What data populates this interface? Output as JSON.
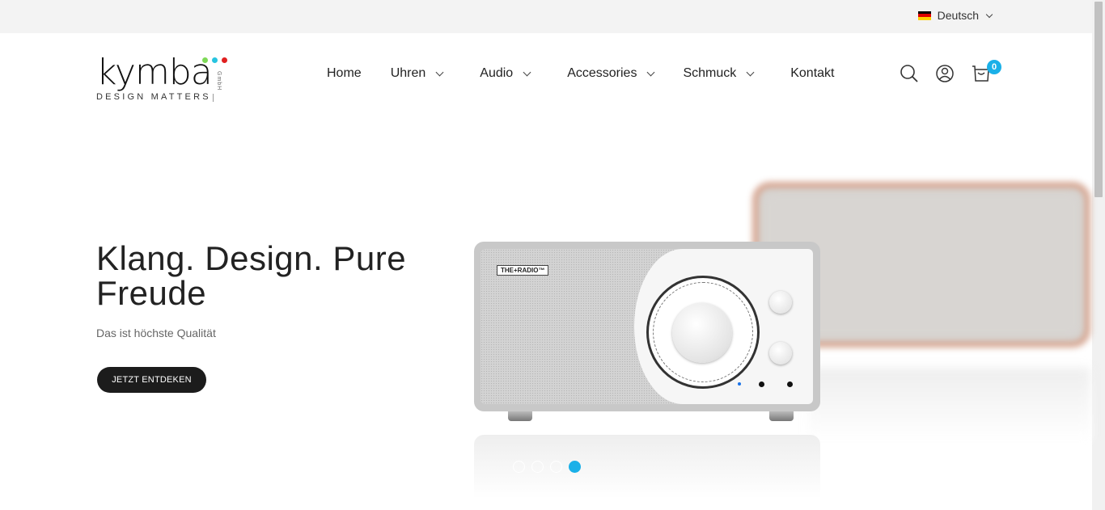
{
  "topbar": {
    "language": "Deutsch"
  },
  "brand": {
    "name": "kymba",
    "tagline": "DESIGN MATTERS",
    "suffix": "GmbH"
  },
  "nav": [
    {
      "label": "Home",
      "has_dropdown": false
    },
    {
      "label": "Uhren",
      "has_dropdown": true
    },
    {
      "label": "Audio",
      "has_dropdown": true
    },
    {
      "label": "Accessories",
      "has_dropdown": true
    },
    {
      "label": "Schmuck",
      "has_dropdown": true
    },
    {
      "label": "Kontakt",
      "has_dropdown": false
    }
  ],
  "header_icons": {
    "search": "search-icon",
    "account": "user-icon",
    "cart": "cart-icon",
    "cart_count": "0"
  },
  "hero": {
    "title": "Klang. Design. Pure Freude",
    "subtitle": "Das ist höchste Qualität",
    "cta": "JETZT ENTDEKEN"
  },
  "product_image": {
    "label": "THE+RADIO™"
  },
  "slider": {
    "count": 4,
    "active_index": 3
  },
  "colors": {
    "accent": "#1ab0e8",
    "cta_bg": "#1c1c1c",
    "topbar_bg": "#f3f3f3"
  }
}
